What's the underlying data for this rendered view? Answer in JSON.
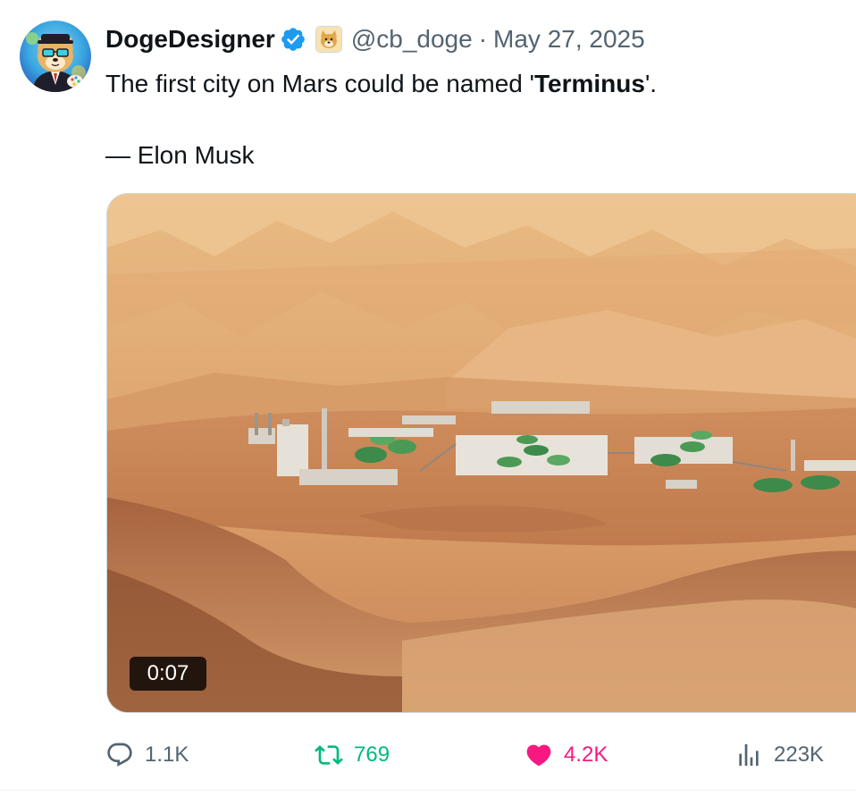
{
  "author": {
    "display_name": "DogeDesigner",
    "handle": "@cb_doge",
    "separator": "·",
    "date": "May 27, 2025",
    "avatar_icon": "doge-avatar-icon",
    "verified_icon": "verified-badge-icon",
    "affiliate_icon": "doge-affiliate-badge-icon"
  },
  "tweet": {
    "text_prefix": "The first city on Mars could be named '",
    "text_bold": "Terminus",
    "text_suffix": "'.",
    "attribution": "— Elon Musk"
  },
  "media": {
    "type": "video",
    "duration": "0:07"
  },
  "actions": {
    "reply": {
      "count": "1.1K",
      "icon": "reply-bubble-icon"
    },
    "retweet": {
      "count": "769",
      "icon": "retweet-icon"
    },
    "like": {
      "count": "4.2K",
      "icon": "heart-icon"
    },
    "views": {
      "count": "223K",
      "icon": "views-bar-chart-icon"
    }
  },
  "colors": {
    "text": "#0f1419",
    "secondary": "#536471",
    "verified": "#1d9bf0",
    "retweet": "#00ba7c",
    "like": "#f91880"
  }
}
